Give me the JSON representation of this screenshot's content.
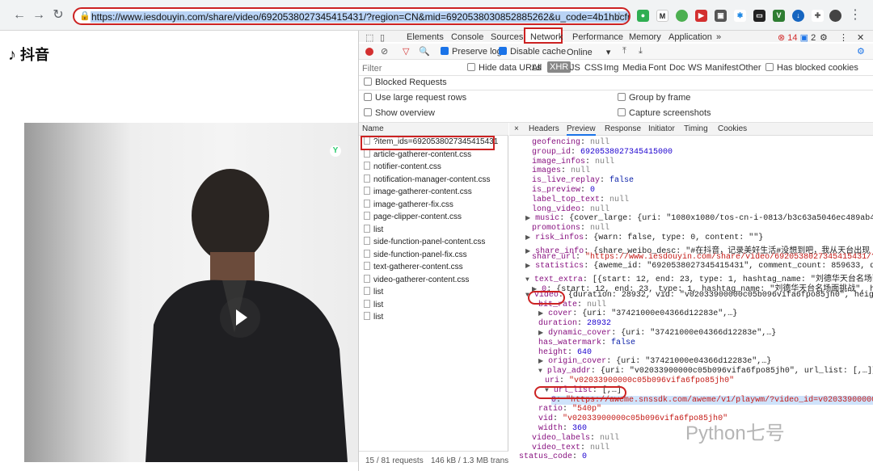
{
  "browser": {
    "url": "https://www.iesdouyin.com/share/video/6920538027345415431/?region=CN&mid=6920538030852885262&u_code=4b1hbcfm5"
  },
  "site": {
    "logo_text": "抖音"
  },
  "devtools": {
    "tabs": [
      "Elements",
      "Console",
      "Sources",
      "Network",
      "Performance",
      "Memory",
      "Application",
      "»"
    ],
    "errors": "14",
    "warnings": "2",
    "toolbar": {
      "preserve_log": "Preserve log",
      "disable_cache": "Disable cache",
      "throttle": "Online"
    },
    "filter": {
      "placeholder": "Filter",
      "hide_data_urls": "Hide data URLs",
      "types": [
        "All",
        "XHR",
        "JS",
        "CSS",
        "Img",
        "Media",
        "Font",
        "Doc",
        "WS",
        "Manifest",
        "Other"
      ],
      "has_blocked": "Has blocked cookies"
    },
    "blocked_requests": "Blocked Requests",
    "options": {
      "large_rows": "Use large request rows",
      "group_frame": "Group by frame",
      "overview": "Show overview",
      "screenshots": "Capture screenshots"
    },
    "name_header": "Name",
    "requests": [
      "?item_ids=6920538027345415431",
      "article-gatherer-content.css",
      "notifier-content.css",
      "notification-manager-content.css",
      "image-gatherer-content.css",
      "image-gatherer-fix.css",
      "page-clipper-content.css",
      "list",
      "side-function-panel-content.css",
      "side-function-panel-fix.css",
      "text-gatherer-content.css",
      "video-gatherer-content.css",
      "list",
      "list",
      "list"
    ],
    "status": {
      "requests": "15 / 81 requests",
      "size": "146 kB / 1.3 MB transfe"
    },
    "detail_tabs": [
      "×",
      "Headers",
      "Preview",
      "Response",
      "Initiator",
      "Timing",
      "Cookies"
    ],
    "preview_lines": [
      {
        "i": 2,
        "t": "",
        "k": "geofencing",
        "v": "null",
        "c": "nl"
      },
      {
        "i": 2,
        "t": "",
        "k": "group_id",
        "v": "6920538027345415000",
        "c": "n"
      },
      {
        "i": 2,
        "t": "",
        "k": "image_infos",
        "v": "null",
        "c": "nl"
      },
      {
        "i": 2,
        "t": "",
        "k": "images",
        "v": "null",
        "c": "nl"
      },
      {
        "i": 2,
        "t": "",
        "k": "is_live_replay",
        "v": "false",
        "c": "b"
      },
      {
        "i": 2,
        "t": "",
        "k": "is_preview",
        "v": "0",
        "c": "n"
      },
      {
        "i": 2,
        "t": "",
        "k": "label_top_text",
        "v": "null",
        "c": "nl"
      },
      {
        "i": 2,
        "t": "",
        "k": "long_video",
        "v": "null",
        "c": "nl"
      },
      {
        "i": 1,
        "t": "▶",
        "k": "music",
        "v": "{cover_large: {uri: \"1080x1080/tos-cn-i-0813/b3c63a5046ec489ab4dd9133",
        "c": ""
      },
      {
        "i": 2,
        "t": "",
        "k": "promotions",
        "v": "null",
        "c": "nl"
      },
      {
        "i": 1,
        "t": "▶",
        "k": "risk_infos",
        "v": "{warn: false, type: 0, content: \"\"}",
        "c": ""
      },
      {
        "i": 1,
        "t": "▶",
        "k": "share_info",
        "v": "{share_weibo_desc: \"#在抖音，记录美好生活#没想到吧，我从天台出现 #刘德华",
        "c": ""
      },
      {
        "i": 2,
        "t": "",
        "k": "share_url",
        "v": "\"https://www.iesdouyin.com/share/video/6920538027345415431/?regic",
        "c": "s"
      },
      {
        "i": 1,
        "t": "▶",
        "k": "statistics",
        "v": "{aweme_id: \"6920538027345415431\", comment_count: 859633, digg_co",
        "c": ""
      },
      {
        "i": 1,
        "t": "▼",
        "k": "text_extra",
        "v": "[{start: 12, end: 23, type: 1, hashtag_name: \"刘德华天台名场面挑战\"",
        "c": ""
      },
      {
        "i": 2,
        "t": "▶",
        "k": "0",
        "v": "{start: 12, end: 23, type: 1, hashtag_name: \"刘德华天台名场面挑战\", hashtag",
        "c": ""
      },
      {
        "i": 1,
        "t": "▼",
        "k": "video",
        "v": "{duration: 28932, vid: \"v02033900000c05b096vifa6fpo85jh0\", height: 64",
        "c": ""
      },
      {
        "i": 3,
        "t": "",
        "k": "bit_rate",
        "v": "null",
        "c": "nl"
      },
      {
        "i": 3,
        "t": "▶",
        "k": "cover",
        "v": "{uri: \"37421000e04366d12283e\",…}",
        "c": ""
      },
      {
        "i": 3,
        "t": "",
        "k": "duration",
        "v": "28932",
        "c": "n"
      },
      {
        "i": 3,
        "t": "▶",
        "k": "dynamic_cover",
        "v": "{uri: \"37421000e04366d12283e\",…}",
        "c": ""
      },
      {
        "i": 3,
        "t": "",
        "k": "has_watermark",
        "v": "false",
        "c": "b"
      },
      {
        "i": 3,
        "t": "",
        "k": "height",
        "v": "640",
        "c": "n"
      },
      {
        "i": 3,
        "t": "▶",
        "k": "origin_cover",
        "v": "{uri: \"37421000e04366d12283e\",…}",
        "c": ""
      },
      {
        "i": 3,
        "t": "▼",
        "k": "play_addr",
        "v": "{uri: \"v02033900000c05b096vifa6fpo85jh0\", url_list: [,…]}",
        "c": ""
      },
      {
        "i": 4,
        "t": "",
        "k": "uri",
        "v": "\"v02033900000c05b096vifa6fpo85jh0\"",
        "c": "s"
      },
      {
        "i": 4,
        "t": "▼",
        "k": "url_list",
        "v": "[,…]",
        "c": ""
      },
      {
        "i": 5,
        "t": "",
        "k": "0",
        "v": "\"https://aweme.snssdk.com/aweme/v1/playwm/?video_id=v02033900000c05b",
        "c": "s"
      },
      {
        "i": 3,
        "t": "",
        "k": "ratio",
        "v": "\"540p\"",
        "c": "s"
      },
      {
        "i": 3,
        "t": "",
        "k": "vid",
        "v": "\"v02033900000c05b096vifa6fpo85jh0\"",
        "c": "s"
      },
      {
        "i": 3,
        "t": "",
        "k": "width",
        "v": "360",
        "c": "n"
      },
      {
        "i": 2,
        "t": "",
        "k": "video_labels",
        "v": "null",
        "c": "nl"
      },
      {
        "i": 2,
        "t": "",
        "k": "video_text",
        "v": "null",
        "c": "nl"
      },
      {
        "i": 0,
        "t": "",
        "k": "status_code",
        "v": "0",
        "c": "n"
      }
    ]
  },
  "watermark": "Python七号"
}
